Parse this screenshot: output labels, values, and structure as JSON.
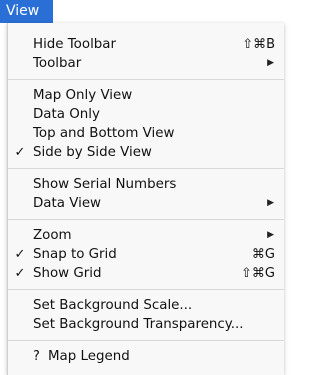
{
  "menubar": {
    "title": "View"
  },
  "menu": {
    "group1": [
      {
        "label": "Hide Toolbar",
        "shortcut": "⇧⌘B"
      },
      {
        "label": "Toolbar",
        "submenu": "▶"
      }
    ],
    "group2": [
      {
        "label": "Map Only View"
      },
      {
        "label": "Data Only"
      },
      {
        "label": "Top and Bottom View"
      },
      {
        "label": "Side by Side View",
        "check": "✓"
      }
    ],
    "group3": [
      {
        "label": "Show Serial Numbers"
      },
      {
        "label": "Data View",
        "submenu": "▶"
      }
    ],
    "group4": [
      {
        "label": "Zoom",
        "submenu": "▶"
      },
      {
        "label": "Snap to Grid",
        "check": "✓",
        "shortcut": "⌘G"
      },
      {
        "label": "Show Grid",
        "check": "✓",
        "shortcut": "⇧⌘G"
      }
    ],
    "group5": [
      {
        "label": "Set Background Scale..."
      },
      {
        "label": "Set Background Transparency..."
      }
    ],
    "group6": [
      {
        "label": "Map Legend",
        "prefix": "?"
      }
    ]
  }
}
